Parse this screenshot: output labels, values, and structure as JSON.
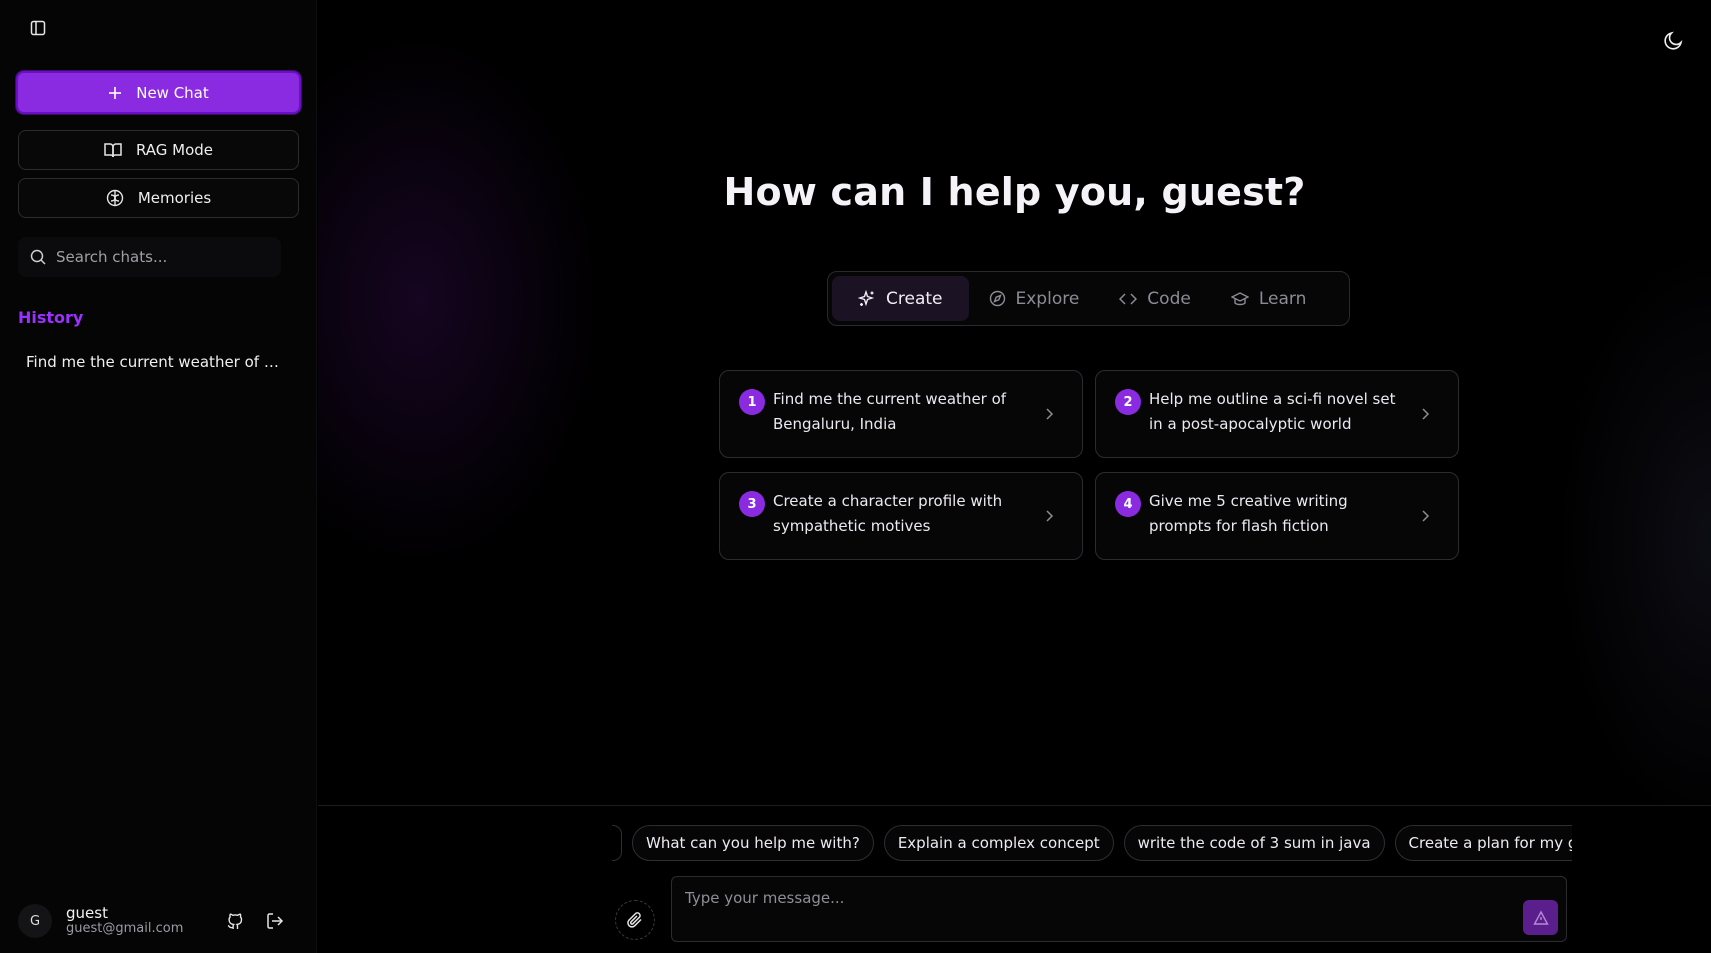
{
  "sidebar": {
    "new_chat_label": "New Chat",
    "rag_mode_label": "RAG Mode",
    "memories_label": "Memories",
    "search_placeholder": "Search chats...",
    "history_title": "History",
    "history_items": [
      {
        "label": "Find me the current weather of Be..."
      }
    ],
    "user": {
      "initial": "G",
      "name": "guest",
      "email": "guest@gmail.com"
    }
  },
  "main": {
    "headline": "How can I help you, guest?",
    "tabs": [
      {
        "label": "Create",
        "icon": "sparkles-icon",
        "active": true
      },
      {
        "label": "Explore",
        "icon": "compass-icon",
        "active": false
      },
      {
        "label": "Code",
        "icon": "code-icon",
        "active": false
      },
      {
        "label": "Learn",
        "icon": "graduation-cap-icon",
        "active": false
      }
    ],
    "suggestions": [
      {
        "num": "1",
        "text": "Find me the current weather of Bengaluru, India"
      },
      {
        "num": "2",
        "text": "Help me outline a sci-fi novel set in a post-apocalyptic world"
      },
      {
        "num": "3",
        "text": "Create a character profile with sympathetic motives"
      },
      {
        "num": "4",
        "text": "Give me 5 creative writing prompts for flash fiction"
      }
    ]
  },
  "composer": {
    "quick_prompts": [
      "What can you help me with?",
      "Explain a complex concept",
      "write the code of 3 sum in java",
      "Create a plan for my goals"
    ],
    "placeholder": "Type your message..."
  },
  "colors": {
    "accent": "#8a2be2",
    "history_title": "#9b30ff",
    "background": "#000000"
  }
}
